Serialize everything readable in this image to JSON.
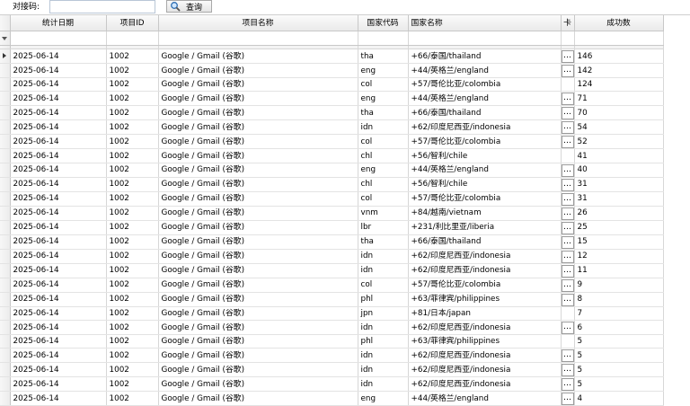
{
  "toolbar": {
    "code_label": "对接码:",
    "code_value": "",
    "query_label": "查询"
  },
  "grid": {
    "columns": [
      "统计日期",
      "项目ID",
      "项目名称",
      "国家代码",
      "国家名称",
      "卡",
      "成功数"
    ],
    "rows": [
      {
        "date": "2025-06-14",
        "pid": "1002",
        "pname": "Google / Gmail (谷歌)",
        "cc": "tha",
        "cname": "+66/泰国/thailand",
        "card": "…",
        "count": "146"
      },
      {
        "date": "2025-06-14",
        "pid": "1002",
        "pname": "Google / Gmail (谷歌)",
        "cc": "eng",
        "cname": "+44/英格兰/england",
        "card": "…",
        "count": "142"
      },
      {
        "date": "2025-06-14",
        "pid": "1002",
        "pname": "Google / Gmail (谷歌)",
        "cc": "col",
        "cname": "+57/哥伦比亚/colombia",
        "card": "",
        "count": "124"
      },
      {
        "date": "2025-06-14",
        "pid": "1002",
        "pname": "Google / Gmail (谷歌)",
        "cc": "eng",
        "cname": "+44/英格兰/england",
        "card": "…",
        "count": "71"
      },
      {
        "date": "2025-06-14",
        "pid": "1002",
        "pname": "Google / Gmail (谷歌)",
        "cc": "tha",
        "cname": "+66/泰国/thailand",
        "card": "…",
        "count": "70"
      },
      {
        "date": "2025-06-14",
        "pid": "1002",
        "pname": "Google / Gmail (谷歌)",
        "cc": "idn",
        "cname": "+62/印度尼西亚/indonesia",
        "card": "…",
        "count": "54"
      },
      {
        "date": "2025-06-14",
        "pid": "1002",
        "pname": "Google / Gmail (谷歌)",
        "cc": "col",
        "cname": "+57/哥伦比亚/colombia",
        "card": "…",
        "count": "52"
      },
      {
        "date": "2025-06-14",
        "pid": "1002",
        "pname": "Google / Gmail (谷歌)",
        "cc": "chl",
        "cname": "+56/智利/chile",
        "card": "",
        "count": "41"
      },
      {
        "date": "2025-06-14",
        "pid": "1002",
        "pname": "Google / Gmail (谷歌)",
        "cc": "eng",
        "cname": "+44/英格兰/england",
        "card": "…",
        "count": "40"
      },
      {
        "date": "2025-06-14",
        "pid": "1002",
        "pname": "Google / Gmail (谷歌)",
        "cc": "chl",
        "cname": "+56/智利/chile",
        "card": "…",
        "count": "31"
      },
      {
        "date": "2025-06-14",
        "pid": "1002",
        "pname": "Google / Gmail (谷歌)",
        "cc": "col",
        "cname": "+57/哥伦比亚/colombia",
        "card": "…",
        "count": "31"
      },
      {
        "date": "2025-06-14",
        "pid": "1002",
        "pname": "Google / Gmail (谷歌)",
        "cc": "vnm",
        "cname": "+84/越南/vietnam",
        "card": "…",
        "count": "26"
      },
      {
        "date": "2025-06-14",
        "pid": "1002",
        "pname": "Google / Gmail (谷歌)",
        "cc": "lbr",
        "cname": "+231/利比里亚/liberia",
        "card": "…",
        "count": "25"
      },
      {
        "date": "2025-06-14",
        "pid": "1002",
        "pname": "Google / Gmail (谷歌)",
        "cc": "tha",
        "cname": "+66/泰国/thailand",
        "card": "…",
        "count": "15"
      },
      {
        "date": "2025-06-14",
        "pid": "1002",
        "pname": "Google / Gmail (谷歌)",
        "cc": "idn",
        "cname": "+62/印度尼西亚/indonesia",
        "card": "…",
        "count": "12"
      },
      {
        "date": "2025-06-14",
        "pid": "1002",
        "pname": "Google / Gmail (谷歌)",
        "cc": "idn",
        "cname": "+62/印度尼西亚/indonesia",
        "card": "…",
        "count": "11"
      },
      {
        "date": "2025-06-14",
        "pid": "1002",
        "pname": "Google / Gmail (谷歌)",
        "cc": "col",
        "cname": "+57/哥伦比亚/colombia",
        "card": "…",
        "count": "9"
      },
      {
        "date": "2025-06-14",
        "pid": "1002",
        "pname": "Google / Gmail (谷歌)",
        "cc": "phl",
        "cname": "+63/菲律宾/philippines",
        "card": "…",
        "count": "8"
      },
      {
        "date": "2025-06-14",
        "pid": "1002",
        "pname": "Google / Gmail (谷歌)",
        "cc": "jpn",
        "cname": "+81/日本/japan",
        "card": "",
        "count": "7"
      },
      {
        "date": "2025-06-14",
        "pid": "1002",
        "pname": "Google / Gmail (谷歌)",
        "cc": "idn",
        "cname": "+62/印度尼西亚/indonesia",
        "card": "…",
        "count": "6"
      },
      {
        "date": "2025-06-14",
        "pid": "1002",
        "pname": "Google / Gmail (谷歌)",
        "cc": "phl",
        "cname": "+63/菲律宾/philippines",
        "card": "",
        "count": "5"
      },
      {
        "date": "2025-06-14",
        "pid": "1002",
        "pname": "Google / Gmail (谷歌)",
        "cc": "idn",
        "cname": "+62/印度尼西亚/indonesia",
        "card": "…",
        "count": "5"
      },
      {
        "date": "2025-06-14",
        "pid": "1002",
        "pname": "Google / Gmail (谷歌)",
        "cc": "idn",
        "cname": "+62/印度尼西亚/indonesia",
        "card": "…",
        "count": "5"
      },
      {
        "date": "2025-06-14",
        "pid": "1002",
        "pname": "Google / Gmail (谷歌)",
        "cc": "idn",
        "cname": "+62/印度尼西亚/indonesia",
        "card": "…",
        "count": "5"
      },
      {
        "date": "2025-06-14",
        "pid": "1002",
        "pname": "Google / Gmail (谷歌)",
        "cc": "eng",
        "cname": "+44/英格兰/england",
        "card": "…",
        "count": "4"
      }
    ]
  }
}
